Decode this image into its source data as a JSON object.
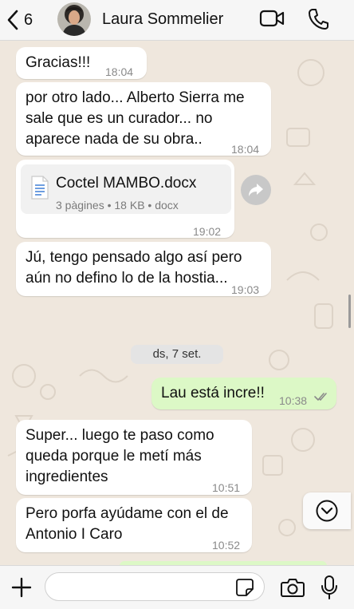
{
  "header": {
    "back_count": "6",
    "contact_name": "Laura Sommelier"
  },
  "messages": [
    {
      "text": "Gracias!!!",
      "time": "18:04"
    },
    {
      "line1": "por otro lado... Alberto Sierra me",
      "line2": "sale que es un curador... no",
      "line3": "aparece nada de su obra..",
      "time": "18:04"
    },
    {
      "doc_name": "Coctel MAMBO.docx",
      "doc_meta": "3 pàgines • 18 KB • docx",
      "time": "19:02"
    },
    {
      "line1": "Jú, tengo pensado algo así pero",
      "line2": "aún no defino lo de la hostia...",
      "time": "19:03"
    },
    {
      "text": "Lau está incre!!",
      "time": "10:38",
      "status": "read"
    },
    {
      "line1": "Super... luego te paso como",
      "line2": "queda porque le metí más",
      "line3": "ingredientes",
      "time": "10:51"
    },
    {
      "line1": "Pero porfa ayúdame con el de",
      "line2": "Antonio I Caro",
      "time": "10:52"
    }
  ],
  "date_separator": "ds, 7 set.",
  "colors": {
    "incoming_bubble": "#ffffff",
    "outgoing_bubble": "#dcf8c6",
    "wallpaper": "#efe7dd",
    "read_ticks": "#8a8a8a"
  },
  "icons": [
    "chevron-left-icon",
    "video-camera-icon",
    "phone-icon",
    "document-icon",
    "forward-icon",
    "double-check-icon",
    "chevron-down-circle-icon",
    "plus-icon",
    "sticker-icon",
    "camera-icon",
    "microphone-icon"
  ]
}
